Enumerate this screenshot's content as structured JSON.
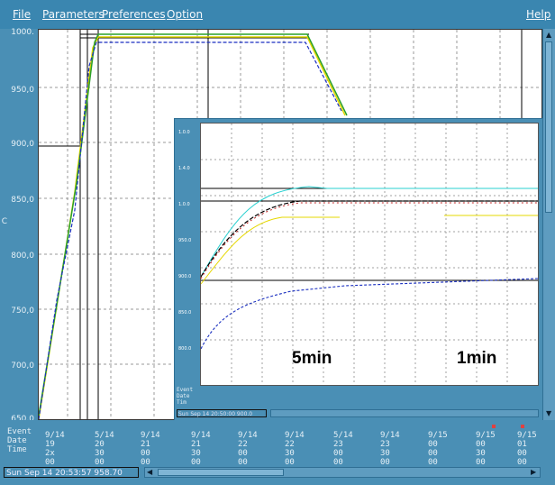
{
  "menu": {
    "file": "File",
    "parameters": "Parameters",
    "preferences": "Preferences",
    "option": "Option",
    "help": "Help"
  },
  "main_plot": {
    "y_ticks": [
      "1000.",
      "950,0",
      "900,0",
      "850,0",
      "800,0",
      "750,0",
      "700,0",
      "650,0"
    ],
    "unit_mark": "C",
    "columns": [
      {
        "date": "9/14",
        "time": "19",
        "min": "2x",
        "sec": "00"
      },
      {
        "date": "5/14",
        "time": "20",
        "min": "30",
        "sec": "00"
      },
      {
        "date": "9/14",
        "time": "21",
        "min": "00",
        "sec": "00"
      },
      {
        "date": "9/14",
        "time": "21",
        "min": "30",
        "sec": "00"
      },
      {
        "date": "9/14",
        "time": "22",
        "min": "00",
        "sec": "00"
      },
      {
        "date": "9/14",
        "time": "22",
        "min": "30",
        "sec": "00"
      },
      {
        "date": "5/14",
        "time": "23",
        "min": "00",
        "sec": "00"
      },
      {
        "date": "9/14",
        "time": "23",
        "min": "30",
        "sec": "00"
      },
      {
        "date": "9/15",
        "time": "00",
        "min": "00",
        "sec": "00"
      },
      {
        "date": "9/15",
        "time": "00",
        "min": "30",
        "sec": "00"
      },
      {
        "date": "9/15",
        "time": "00",
        "min": "30",
        "sec": "00"
      },
      {
        "date": "9/15",
        "time": "01",
        "min": "00",
        "sec": "00"
      }
    ],
    "row_labels": {
      "event": "Event",
      "date": "Date",
      "time": "Time"
    }
  },
  "inset": {
    "label_5min": "5min",
    "label_1min": "1min",
    "status_text": "Sun Sep 14 20:50:00 900.0",
    "row_labels": {
      "event": "Event",
      "date": "Date",
      "time": "Tim"
    }
  },
  "status_bar": {
    "text": "Sun Sep 14 20:53:57 958.70"
  },
  "colors": {
    "background": "#4a8fb5",
    "series_blue": "#1a2fc0",
    "series_green": "#2aa02a",
    "series_yellow": "#e6d800",
    "series_cyan": "#2ad0d0",
    "series_red": "#c02020",
    "series_black": "#000000"
  }
}
